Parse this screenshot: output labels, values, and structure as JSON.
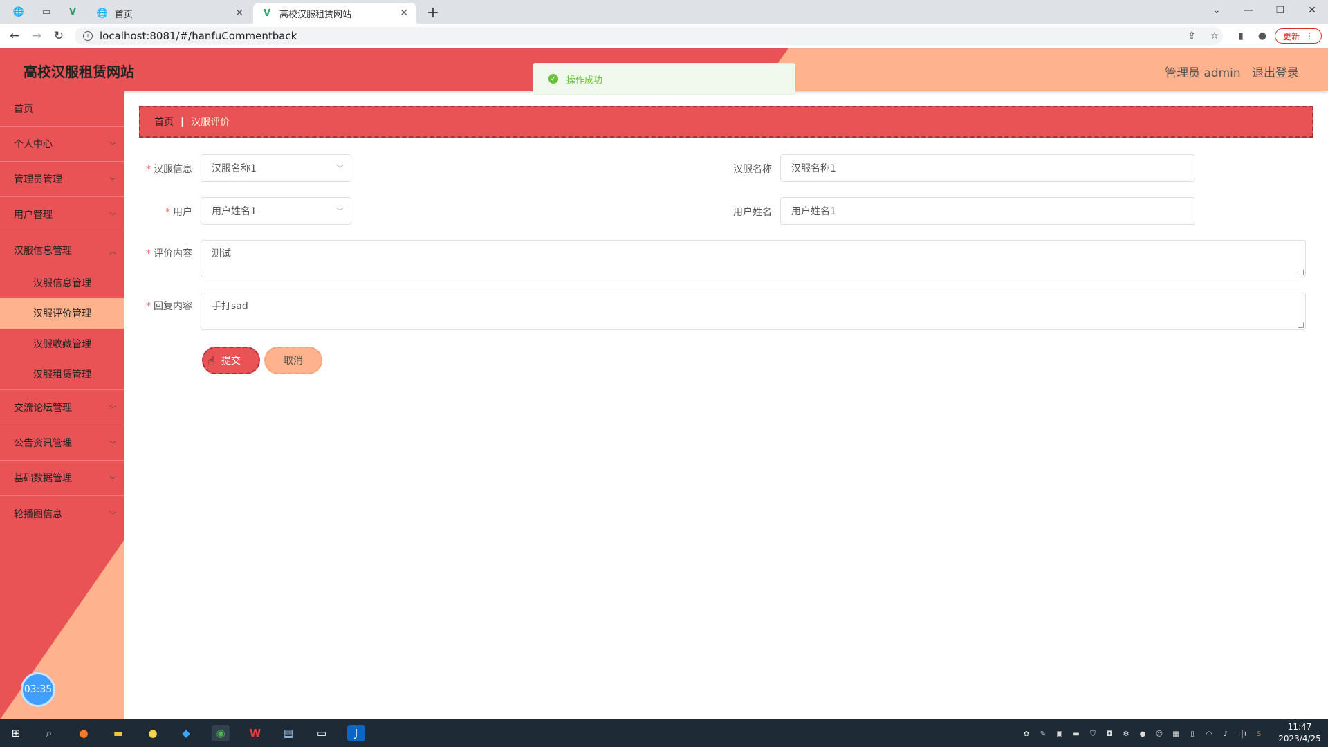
{
  "browser": {
    "tabs": [
      {
        "label": "首页",
        "active": false
      },
      {
        "label": "高校汉服租赁网站",
        "active": true
      }
    ],
    "url": "localhost:8081/#/hanfuCommentback",
    "update_label": "更新"
  },
  "header": {
    "title": "高校汉服租赁网站",
    "user_label": "管理员 admin",
    "logout_label": "退出登录"
  },
  "toast": {
    "message": "操作成功"
  },
  "sidebar": {
    "items": [
      {
        "label": "首页"
      },
      {
        "label": "个人中心"
      },
      {
        "label": "管理员管理"
      },
      {
        "label": "用户管理"
      },
      {
        "label": "汉服信息管理",
        "expanded": true
      },
      {
        "label": "交流论坛管理"
      },
      {
        "label": "公告资讯管理"
      },
      {
        "label": "基础数据管理"
      },
      {
        "label": "轮播图信息"
      }
    ],
    "subitems": [
      {
        "label": "汉服信息管理"
      },
      {
        "label": "汉服评价管理",
        "active": true
      },
      {
        "label": "汉服收藏管理"
      },
      {
        "label": "汉服租赁管理"
      }
    ],
    "timer": "03:35"
  },
  "breadcrumb": {
    "home": "首页",
    "current": "汉服评价"
  },
  "form": {
    "hanfu_info_label": "汉服信息",
    "hanfu_info_value": "汉服名称1",
    "hanfu_name_label": "汉服名称",
    "hanfu_name_value": "汉服名称1",
    "user_label": "用户",
    "user_value": "用户姓名1",
    "user_name_label": "用户姓名",
    "user_name_value": "用户姓名1",
    "comment_label": "评价内容",
    "comment_value": "测试",
    "reply_label": "回复内容",
    "reply_value": "手打sad",
    "submit_label": "提交",
    "cancel_label": "取消"
  },
  "taskbar": {
    "time": "11:47",
    "date": "2023/4/25",
    "ime": "中"
  },
  "colors": {
    "primary_red": "#e95356",
    "accent_peach": "#ffb28b",
    "success_green": "#67c23a"
  }
}
